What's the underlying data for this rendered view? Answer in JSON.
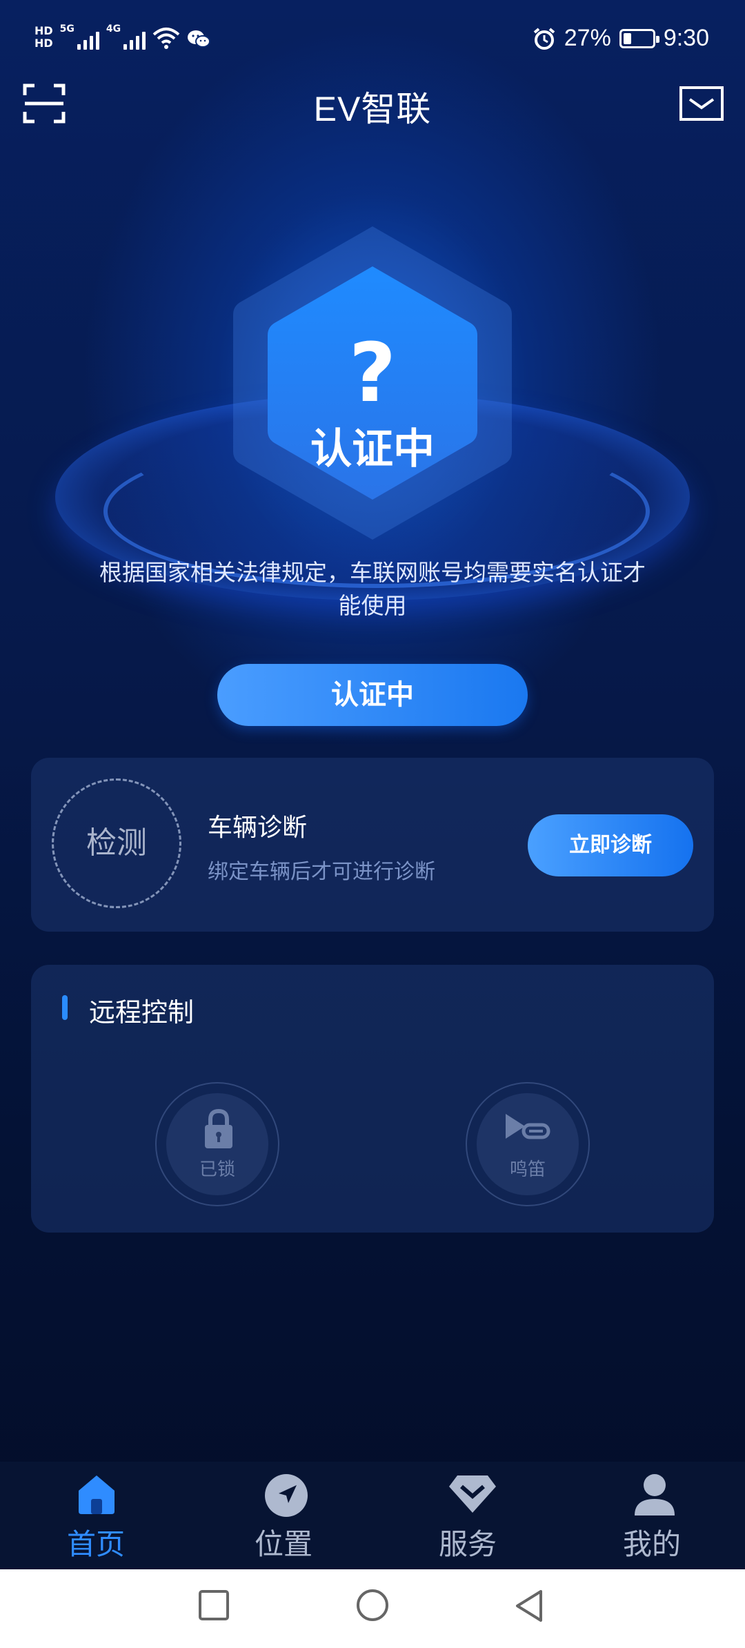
{
  "status_bar": {
    "hd1": "HD",
    "hd2": "HD",
    "net1": "5G",
    "net2": "4G",
    "battery_percent": "27%",
    "battery_level": 0.27,
    "time": "9:30",
    "icons": [
      "signal-icon",
      "wifi-icon",
      "wechat-icon",
      "alarm-icon",
      "battery-icon"
    ]
  },
  "header": {
    "title": "EV智联",
    "left_icon": "scan-icon",
    "right_icon": "mail-icon"
  },
  "hero": {
    "hex_symbol": "?",
    "hex_status": "认证中",
    "notice": "根据国家相关法律规定，车联网账号均需要实名认证才能使用",
    "button_label": "认证中"
  },
  "diagnosis": {
    "circle_label": "检测",
    "title": "车辆诊断",
    "subtitle": "绑定车辆后才可进行诊断",
    "button_label": "立即诊断"
  },
  "remote": {
    "title": "远程控制",
    "controls": [
      {
        "label": "已锁",
        "icon": "lock-icon"
      },
      {
        "label": "鸣笛",
        "icon": "horn-icon"
      }
    ]
  },
  "bottom_nav": {
    "items": [
      {
        "label": "首页",
        "icon": "home-icon",
        "active": true
      },
      {
        "label": "位置",
        "icon": "location-icon",
        "active": false
      },
      {
        "label": "服务",
        "icon": "service-icon",
        "active": false
      },
      {
        "label": "我的",
        "icon": "profile-icon",
        "active": false
      }
    ]
  },
  "colors": {
    "accent": "#2f8cff",
    "background": "#061534",
    "card": "#1c346e",
    "muted_text": "#7b93c7"
  }
}
